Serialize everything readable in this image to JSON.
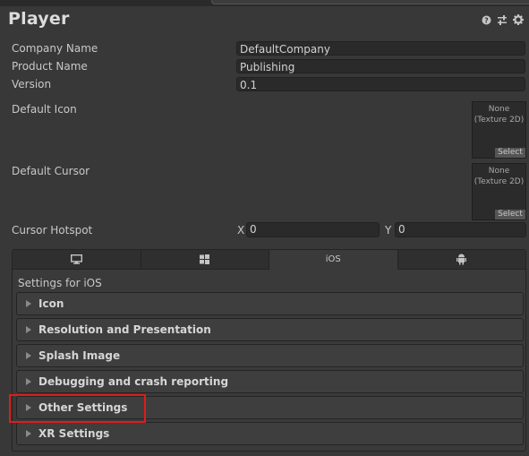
{
  "title": "Player",
  "header_icons": [
    "help-icon",
    "presets-icon",
    "gear-icon"
  ],
  "fields": {
    "company_name": {
      "label": "Company Name",
      "value": "DefaultCompany"
    },
    "product_name": {
      "label": "Product Name",
      "value": "Publishing"
    },
    "version": {
      "label": "Version",
      "value": "0.1"
    }
  },
  "default_icon": {
    "label": "Default Icon",
    "none": "None",
    "type": "(Texture 2D)",
    "select": "Select"
  },
  "default_cursor": {
    "label": "Default Cursor",
    "none": "None",
    "type": "(Texture 2D)",
    "select": "Select"
  },
  "cursor_hotspot": {
    "label": "Cursor Hotspot",
    "x_label": "X",
    "x_value": "0",
    "y_label": "Y",
    "y_value": "0"
  },
  "tabs": [
    {
      "name": "standalone-icon",
      "label": ""
    },
    {
      "name": "windows-icon",
      "label": ""
    },
    {
      "name": "ios",
      "label": "iOS"
    },
    {
      "name": "android-icon",
      "label": ""
    }
  ],
  "settings_for": "Settings for iOS",
  "sections": [
    "Icon",
    "Resolution and Presentation",
    "Splash Image",
    "Debugging and crash reporting",
    "Other Settings",
    "XR Settings"
  ],
  "colors": {
    "highlight": "#e01b1b",
    "background": "#383838"
  }
}
